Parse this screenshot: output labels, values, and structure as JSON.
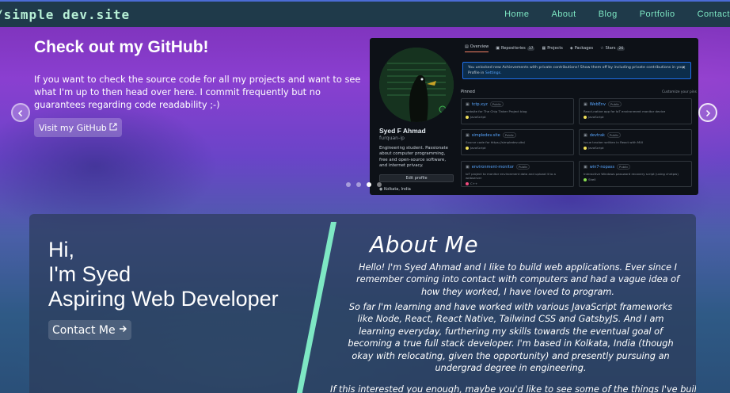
{
  "navbar": {
    "brand": "/simple dev.site",
    "links": [
      "Home",
      "About",
      "Blog",
      "Portfolio",
      "Contact"
    ]
  },
  "carousel": {
    "title": "Check out my GitHub!",
    "text": "If you want to check the source code for all my projects and want to see what I'm up to then head over here. I commit frequently but no guarantees regarding code readability ;-)",
    "button_label": "Visit my GitHub",
    "active_slide": 3,
    "slide_count": 4
  },
  "github_preview": {
    "tabs": [
      {
        "label": "Overview",
        "count": ""
      },
      {
        "label": "Repositories",
        "count": "17"
      },
      {
        "label": "Projects",
        "count": ""
      },
      {
        "label": "Packages",
        "count": ""
      },
      {
        "label": "Stars",
        "count": "26"
      }
    ],
    "notice": "You unlocked new Achievements with private contributions! Show them off by including private contributions in your Profile in",
    "notice_link": "Settings.",
    "name": "Syed F Ahmad",
    "username": "furquan-ip",
    "bio": "Engineering student. Passionate about computer programming, free and open-source software, and internet privacy.",
    "edit_label": "Edit profile",
    "location": "Kolkata, India",
    "pinned_label": "Pinned",
    "customize_label": "Customize your pins",
    "public_label": "Public",
    "repos": [
      {
        "name": "tctp.xyz",
        "desc": "website for The Chip Tinker Project blog",
        "lang": "JavaScript",
        "color": "#f1e05a"
      },
      {
        "name": "WebEnv",
        "desc": "React-native app for IoT environment monitor device",
        "lang": "JavaScript",
        "color": "#f1e05a"
      },
      {
        "name": "simpledev.site",
        "desc": "Source code for https://simpledev.site/",
        "lang": "JavaScript",
        "color": "#f1e05a"
      },
      {
        "name": "devtrak",
        "desc": "Issue tracker written in React with MUI",
        "lang": "JavaScript",
        "color": "#f1e05a"
      },
      {
        "name": "environment-monitor",
        "desc": "IoT project to monitor environment data and upload it to a webserver",
        "lang": "C++",
        "color": "#f34b7d"
      },
      {
        "name": "win7-nopass",
        "desc": "Interactive Windows password recovery script (using chntpw)",
        "lang": "Shell",
        "color": "#89e051"
      }
    ]
  },
  "about": {
    "greeting_line1": "Hi,",
    "greeting_line2": "I'm Syed",
    "greeting_line3": "Aspiring Web Developer",
    "contact_label": "Contact Me",
    "title": "About Me",
    "p1": "Hello! I'm Syed Ahmad and I like to build web applications. Ever since I remember coming into contact with computers and had a vague idea of how they worked, I have loved to program.",
    "p2": "So far I'm learning and have worked with various JavaScript frameworks like Node, React, React Native, Tailwind CSS and GatsbyJS. And I am learning everyday, furthering my skills towards the eventual goal of becoming a true full stack developer. I'm based in Kolkata, India (though okay with relocating, given the opportunity) and presently pursuing an undergrad degree in engineering.",
    "p3": "If this interested you enough, maybe you'd like to see some of the things I've built or"
  },
  "colors": {
    "nav_bg": "#1f3a4a",
    "nav_link": "#7ee8c4",
    "brand": "#b7f0d6",
    "accent_slash": "#7ee8c4"
  }
}
